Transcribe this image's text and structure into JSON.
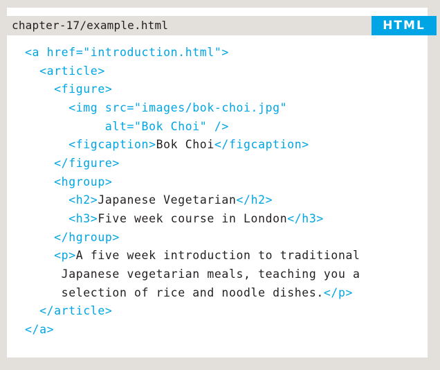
{
  "header": {
    "filename": "chapter-17/example.html",
    "badge": "HTML"
  },
  "colors": {
    "background": "#e3dfdb",
    "panel": "#ffffff",
    "accent": "#00a5e5",
    "text": "#231f20"
  },
  "code_lines": [
    [
      {
        "t": "tag",
        "s": "<a href=\"introduction.html\">"
      }
    ],
    [
      {
        "t": "tag",
        "s": "  <article>"
      }
    ],
    [
      {
        "t": "tag",
        "s": "    <figure>"
      }
    ],
    [
      {
        "t": "tag",
        "s": "      <img src=\"images/bok-choi.jpg\""
      }
    ],
    [
      {
        "t": "tag",
        "s": "           alt=\"Bok Choi\" />"
      }
    ],
    [
      {
        "t": "tag",
        "s": "      <figcaption>"
      },
      {
        "t": "txt",
        "s": "Bok Choi"
      },
      {
        "t": "tag",
        "s": "</figcaption>"
      }
    ],
    [
      {
        "t": "tag",
        "s": "    </figure>"
      }
    ],
    [
      {
        "t": "tag",
        "s": "    <hgroup>"
      }
    ],
    [
      {
        "t": "tag",
        "s": "      <h2>"
      },
      {
        "t": "txt",
        "s": "Japanese Vegetarian"
      },
      {
        "t": "tag",
        "s": "</h2>"
      }
    ],
    [
      {
        "t": "tag",
        "s": "      <h3>"
      },
      {
        "t": "txt",
        "s": "Five week course in London"
      },
      {
        "t": "tag",
        "s": "</h3>"
      }
    ],
    [
      {
        "t": "tag",
        "s": "    </hgroup>"
      }
    ],
    [
      {
        "t": "tag",
        "s": "    <p>"
      },
      {
        "t": "txt",
        "s": "A five week introduction to traditional"
      }
    ],
    [
      {
        "t": "txt",
        "s": "     Japanese vegetarian meals, teaching you a"
      }
    ],
    [
      {
        "t": "txt",
        "s": "     selection of rice and noodle dishes."
      },
      {
        "t": "tag",
        "s": "</p>"
      }
    ],
    [
      {
        "t": "tag",
        "s": "  </article>"
      }
    ],
    [
      {
        "t": "tag",
        "s": "</a>"
      }
    ]
  ]
}
